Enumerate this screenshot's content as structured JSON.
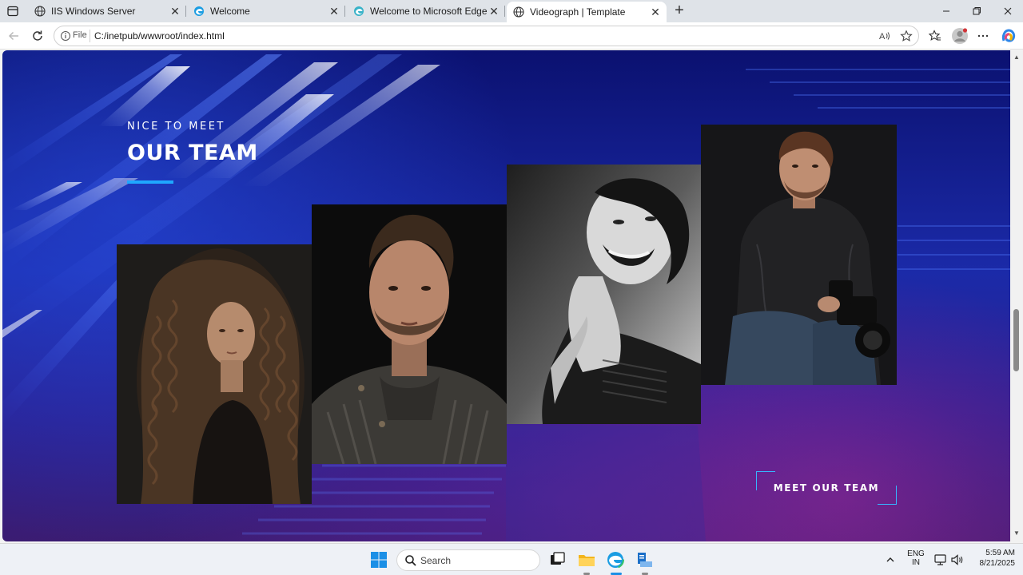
{
  "browser": {
    "tabs": [
      {
        "title": "IIS Windows Server",
        "favicon": "globe-icon",
        "active": false
      },
      {
        "title": "Welcome",
        "favicon": "edge-icon",
        "active": false
      },
      {
        "title": "Welcome to Microsoft Edge",
        "favicon": "edge-icon",
        "active": false
      },
      {
        "title": "Videograph | Template",
        "favicon": "globe-icon",
        "active": true
      }
    ],
    "close_glyph": "✕",
    "new_tab_glyph": "+",
    "address": {
      "scheme_label": "File",
      "url": "C:/inetpub/wwwroot/index.html"
    }
  },
  "page": {
    "section_kicker": "NICE TO MEET",
    "section_title": "OUR TEAM",
    "cta_label": "MEET OUR TEAM",
    "accent_color": "#1fa7ff",
    "team_photos": [
      {
        "description": "curly-haired-woman-portrait"
      },
      {
        "description": "bearded-man-sweater-portrait"
      },
      {
        "description": "smiling-woman-black-and-white"
      },
      {
        "description": "photographer-with-camera"
      }
    ]
  },
  "taskbar": {
    "search_placeholder": "Search",
    "language_line1": "ENG",
    "language_line2": "IN",
    "time": "5:59 AM",
    "date": "8/21/2025"
  }
}
